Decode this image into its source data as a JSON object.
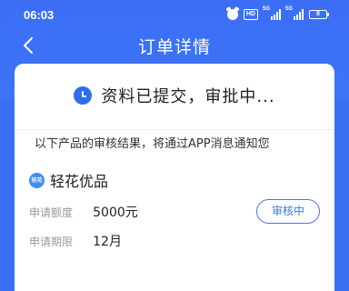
{
  "status_bar": {
    "time": "06:03",
    "hd": "HD",
    "network1": "5G",
    "network2": "5G",
    "battery": "8"
  },
  "nav": {
    "title": "订单详情",
    "back_icon": "chevron-left-icon"
  },
  "order": {
    "status_text": "资料已提交，审批中...",
    "status_icon": "clock-icon",
    "notice": "以下产品的审核结果，将通过APP消息通知您",
    "product": {
      "logo_text": "轻花",
      "name": "轻花优品"
    },
    "amount_label": "申请额度",
    "amount_value": "5000元",
    "term_label": "申请期限",
    "term_value": "12月",
    "review_button": "审核中"
  },
  "colors": {
    "header_blue": "#3b6ef5",
    "accent": "#3e74f4"
  }
}
